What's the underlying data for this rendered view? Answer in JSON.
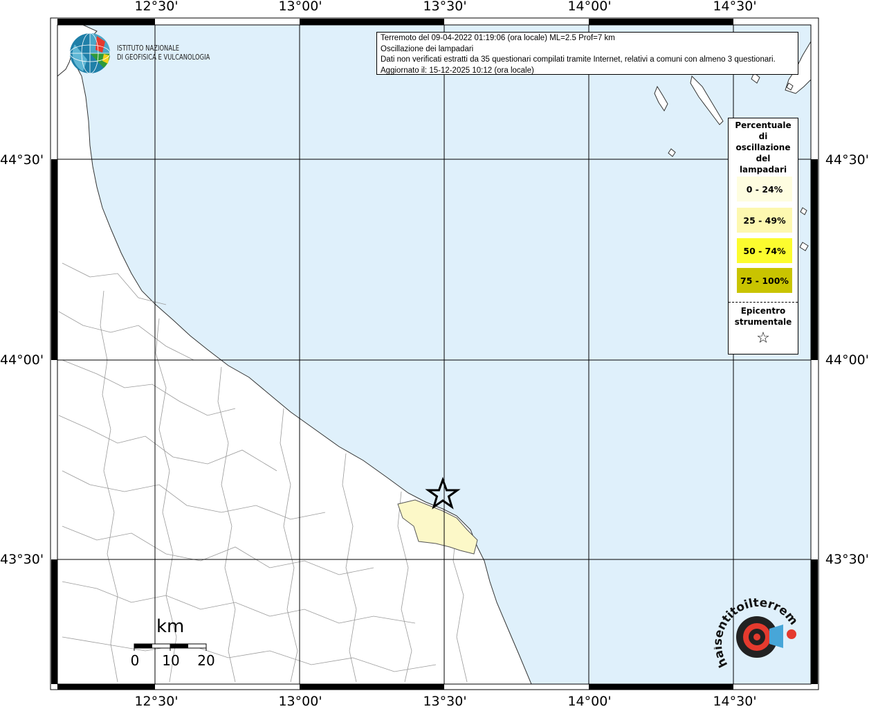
{
  "info_box": {
    "line1": "Terremoto del 09-04-2022 01:19:06 (ora locale) ML=2.5 Prof=7 km",
    "line2": "Oscillazione dei lampadari",
    "line3": "Dati non verificati estratti da 35 questionari compilati tramite Internet, relativi a comuni con almeno 3 questionari.",
    "line4": "Aggiornato il: 15-12-2025 10:12 (ora locale)"
  },
  "logo": {
    "line1": "ISTITUTO NAZIONALE",
    "line2": "DI GEOFISICA E VULCANOLOGIA"
  },
  "legend": {
    "title_lines": [
      "Percentuale",
      "di",
      "oscillazione",
      "del",
      "lampadari"
    ],
    "items": [
      {
        "label": "0 - 24%",
        "color": "#fefde0"
      },
      {
        "label": "25 - 49%",
        "color": "#fdf8b0"
      },
      {
        "label": "50 - 74%",
        "color": "#fcfc2e"
      },
      {
        "label": "75 - 100%",
        "color": "#c9c400"
      }
    ],
    "epicenter_lines": [
      "Epicentro",
      "strumentale"
    ],
    "epicenter_symbol": "☆"
  },
  "axes": {
    "lon_labels": [
      "12°30'",
      "13°00'",
      "13°30'",
      "14°00'",
      "14°30'"
    ],
    "lat_labels": [
      "44°30'",
      "44°00'",
      "43°30'"
    ]
  },
  "scale_bar": {
    "unit": "km",
    "labels": [
      "0",
      "10",
      "20"
    ]
  },
  "branding": {
    "text": "haisentitoilterremoto.it"
  },
  "colors": {
    "sea": "#dff0fb",
    "land": "#ffffff",
    "felt_area": "#fcf8c8",
    "grid": "#000000"
  }
}
